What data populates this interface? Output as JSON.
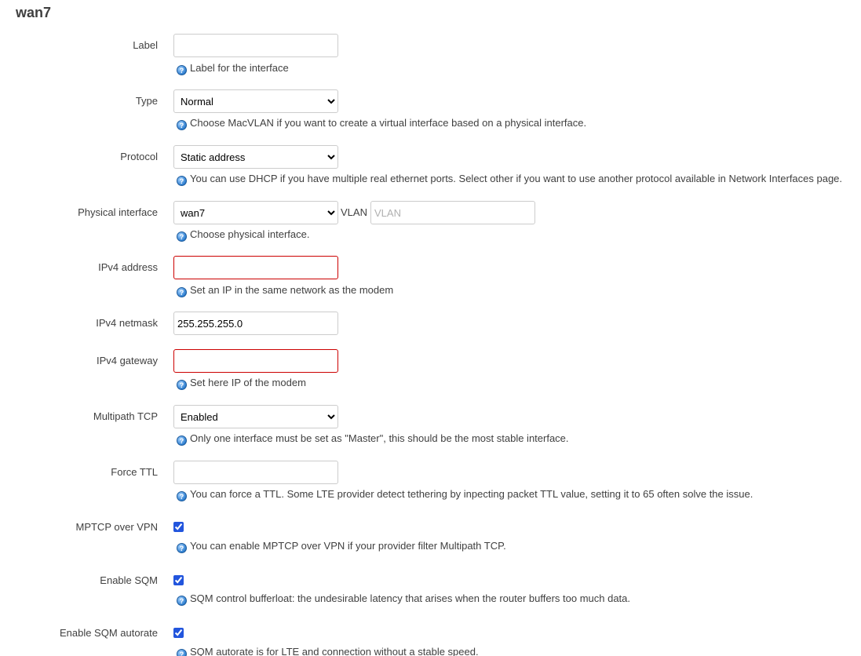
{
  "section": {
    "title": "wan7"
  },
  "fields": {
    "label": {
      "label": "Label",
      "value": "",
      "help": "Label for the interface"
    },
    "type": {
      "label": "Type",
      "selected": "Normal",
      "help": "Choose MacVLAN if you want to create a virtual interface based on a physical interface."
    },
    "protocol": {
      "label": "Protocol",
      "selected": "Static address",
      "help": "You can use DHCP if you have multiple real ethernet ports. Select other if you want to use another protocol available in Network Interfaces page."
    },
    "physical": {
      "label": "Physical interface",
      "selected": "wan7",
      "vlan_label": "VLAN",
      "vlan_placeholder": "VLAN",
      "help": "Choose physical interface."
    },
    "ipv4_address": {
      "label": "IPv4 address",
      "value": "",
      "help": "Set an IP in the same network as the modem"
    },
    "ipv4_netmask": {
      "label": "IPv4 netmask",
      "value": "255.255.255.0"
    },
    "ipv4_gateway": {
      "label": "IPv4 gateway",
      "value": "",
      "help": "Set here IP of the modem"
    },
    "multipath": {
      "label": "Multipath TCP",
      "selected": "Enabled",
      "help": "Only one interface must be set as \"Master\", this should be the most stable interface."
    },
    "force_ttl": {
      "label": "Force TTL",
      "value": "",
      "help": "You can force a TTL. Some LTE provider detect tethering by inpecting packet TTL value, setting it to 65 often solve the issue."
    },
    "mptcp_vpn": {
      "label": "MPTCP over VPN",
      "checked": true,
      "help": "You can enable MPTCP over VPN if your provider filter Multipath TCP."
    },
    "sqm": {
      "label": "Enable SQM",
      "checked": true,
      "help": "SQM control bufferloat: the undesirable latency that arises when the router buffers too much data."
    },
    "sqm_autorate": {
      "label": "Enable SQM autorate",
      "checked": true,
      "help": "SQM autorate is for LTE and connection without a stable speed."
    }
  },
  "icons": {
    "help": "help-question-icon"
  },
  "colors": {
    "invalid_border": "#cc0000",
    "checkbox_accent": "#2255dd"
  }
}
